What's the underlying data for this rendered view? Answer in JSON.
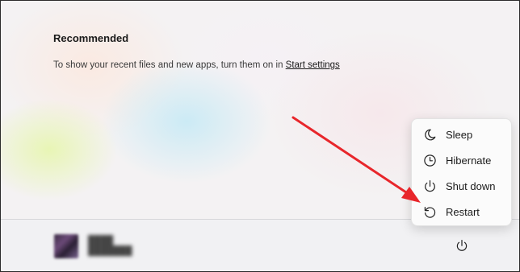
{
  "recommended": {
    "title": "Recommended",
    "message": "To show your recent files and new apps, turn them on in ",
    "link_label": "Start settings"
  },
  "user": {
    "name_line1": "████",
    "name_line2": "███████"
  },
  "power_menu": {
    "items": [
      {
        "label": "Sleep",
        "icon": "moon-icon"
      },
      {
        "label": "Hibernate",
        "icon": "clock-icon"
      },
      {
        "label": "Shut down",
        "icon": "power-icon"
      },
      {
        "label": "Restart",
        "icon": "restart-icon"
      }
    ]
  },
  "colors": {
    "annotation_arrow": "#e8262b"
  }
}
